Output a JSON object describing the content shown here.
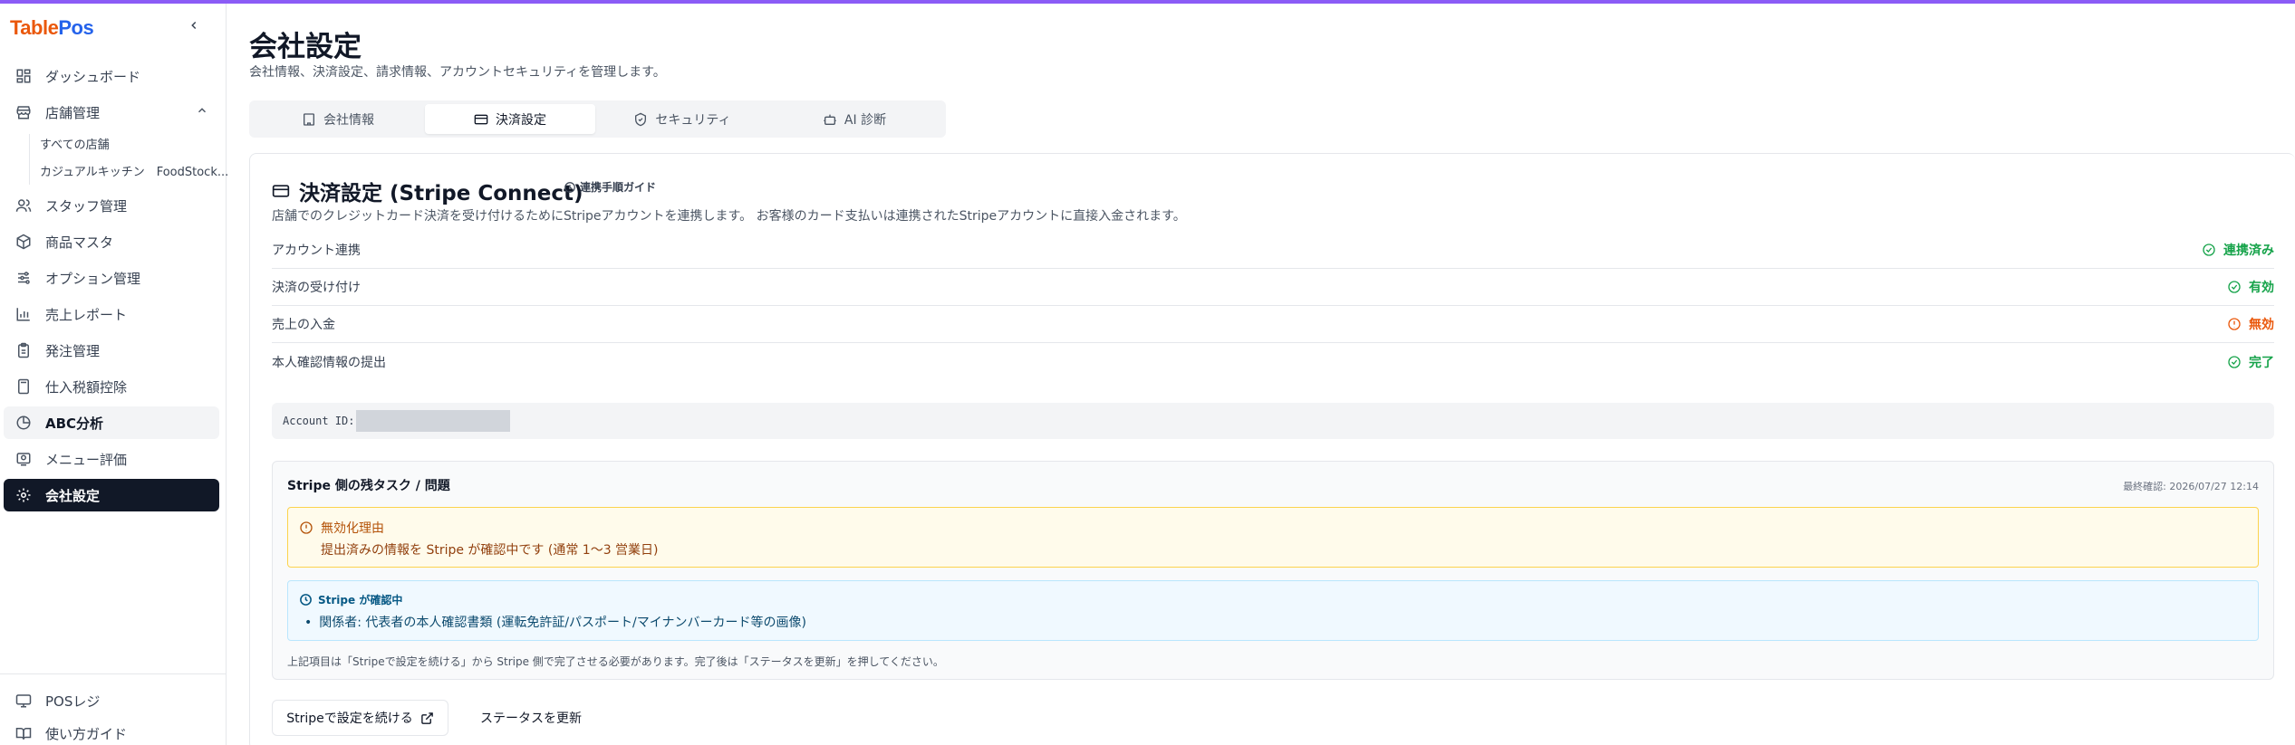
{
  "brand": {
    "part1": "Table",
    "part2": "Pos"
  },
  "sidebar": {
    "items": [
      {
        "label": "ダッシュボード"
      },
      {
        "label": "店舗管理"
      },
      {
        "label": "スタッフ管理"
      },
      {
        "label": "商品マスタ"
      },
      {
        "label": "オプション管理"
      },
      {
        "label": "売上レポート"
      },
      {
        "label": "発注管理"
      },
      {
        "label": "仕入税額控除"
      },
      {
        "label": "ABC分析"
      },
      {
        "label": "メニュー評価"
      },
      {
        "label": "会社設定"
      }
    ],
    "sub_items": [
      {
        "label": "すべての店舗"
      },
      {
        "label": "カジュアルキッチン　FoodStock..."
      }
    ],
    "bottom_items": [
      {
        "label": "POSレジ"
      },
      {
        "label": "使い方ガイド"
      }
    ]
  },
  "page": {
    "title": "会社設定",
    "subtitle": "会社情報、決済設定、請求情報、アカウントセキュリティを管理します。"
  },
  "tabs": [
    {
      "label": "会社情報"
    },
    {
      "label": "決済設定"
    },
    {
      "label": "セキュリティ"
    },
    {
      "label": "AI 診断"
    }
  ],
  "payment": {
    "title": "決済設定 (Stripe Connect)",
    "guide_link": "連携手順ガイド",
    "description": "店舗でのクレジットカード決済を受け付けるためにStripeアカウントを連携します。 お客様のカード支払いは連携されたStripeアカウントに直接入金されます。",
    "statuses": [
      {
        "label": "アカウント連携",
        "value": "連携済み",
        "state": "ok"
      },
      {
        "label": "決済の受け付け",
        "value": "有効",
        "state": "ok"
      },
      {
        "label": "売上の入金",
        "value": "無効",
        "state": "warn"
      },
      {
        "label": "本人確認情報の提出",
        "value": "完了",
        "state": "ok"
      }
    ],
    "account_label": "Account ID:"
  },
  "tasks": {
    "title": "Stripe 側の残タスク / 問題",
    "last_checked": "最終確認: 2026/07/27 12:14",
    "warning_title": "無効化理由",
    "warning_text": "提出済みの情報を Stripe が確認中です (通常 1〜3 営業日)",
    "info_title": "Stripe が確認中",
    "info_item": "関係者: 代表者の本人確認書類 (運転免許証/パスポート/マイナンバーカード等の画像)",
    "note": "上記項目は「Stripeで設定を続ける」から Stripe 側で完了させる必要があります。完了後は「ステータスを更新」を押してください。"
  },
  "actions": {
    "continue_stripe": "Stripeで設定を続ける",
    "refresh_status": "ステータスを更新"
  },
  "colors": {
    "accent": "#8b5cf6",
    "active_nav": "#111827",
    "ok": "#16a34a",
    "warn": "#ea580c"
  }
}
